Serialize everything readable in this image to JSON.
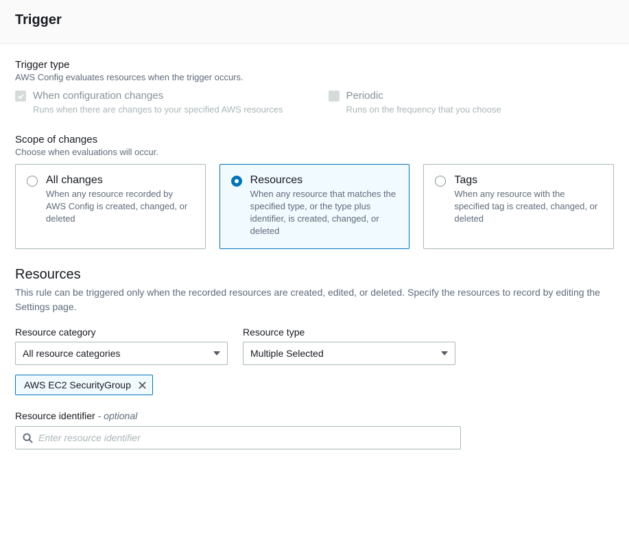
{
  "header": {
    "title": "Trigger"
  },
  "trigger_type": {
    "label": "Trigger type",
    "sub": "AWS Config evaluates resources when the trigger occurs.",
    "config_changes": {
      "title": "When configuration changes",
      "desc": "Runs when there are changes to your specified AWS resources"
    },
    "periodic": {
      "title": "Periodic",
      "desc": "Runs on the frequency that you choose"
    }
  },
  "scope": {
    "label": "Scope of changes",
    "sub": "Choose when evaluations will occur.",
    "all": {
      "title": "All changes",
      "desc": "When any resource recorded by AWS Config is created, changed, or deleted"
    },
    "resources": {
      "title": "Resources",
      "desc": "When any resource that matches the specified type, or the type plus identifier, is created, changed, or deleted"
    },
    "tags": {
      "title": "Tags",
      "desc": "When any resource with the specified tag is created, changed, or deleted"
    }
  },
  "resources": {
    "heading": "Resources",
    "desc": "This rule can be triggered only when the recorded resources are created, edited, or deleted. Specify the resources to record by editing the Settings page.",
    "category_label": "Resource category",
    "category_value": "All resource categories",
    "type_label": "Resource type",
    "type_value": "Multiple Selected",
    "chip": "AWS EC2 SecurityGroup",
    "identifier_label": "Resource identifier",
    "identifier_optional": " - optional",
    "identifier_placeholder": "Enter resource identifier"
  }
}
